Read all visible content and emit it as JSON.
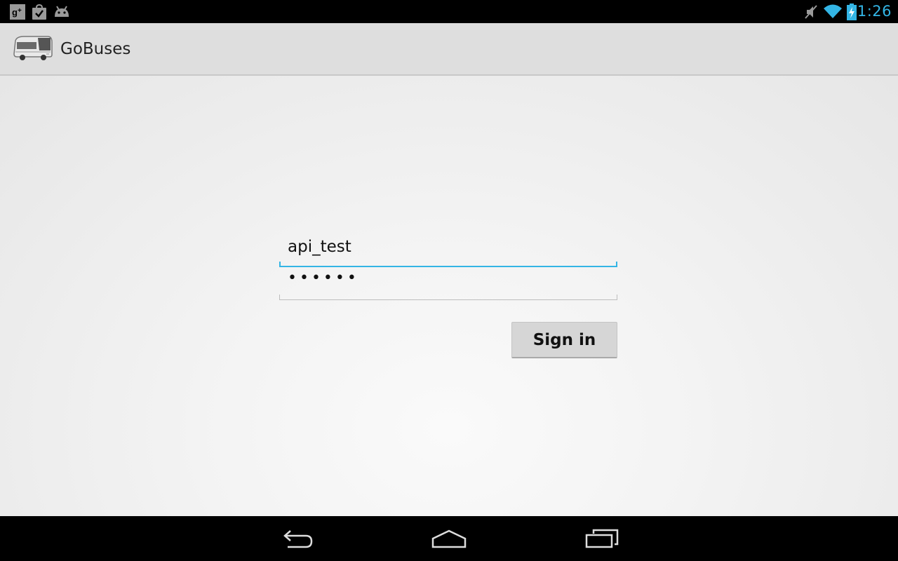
{
  "status_bar": {
    "left_icons": [
      "google-plus-icon",
      "play-store-icon",
      "android-icon"
    ],
    "right_icons": [
      "mute-icon",
      "wifi-icon",
      "battery-charging-icon"
    ],
    "time": "1:26",
    "accent": "#33b5e5"
  },
  "action_bar": {
    "app_icon": "bus-icon",
    "title": "GoBuses"
  },
  "login": {
    "username_value": "api_test",
    "password_value": "••••••",
    "sign_in_label": "Sign in",
    "focus_color": "#33b5e5"
  },
  "nav_bar": {
    "buttons": [
      "back-icon",
      "home-icon",
      "recent-apps-icon"
    ]
  }
}
